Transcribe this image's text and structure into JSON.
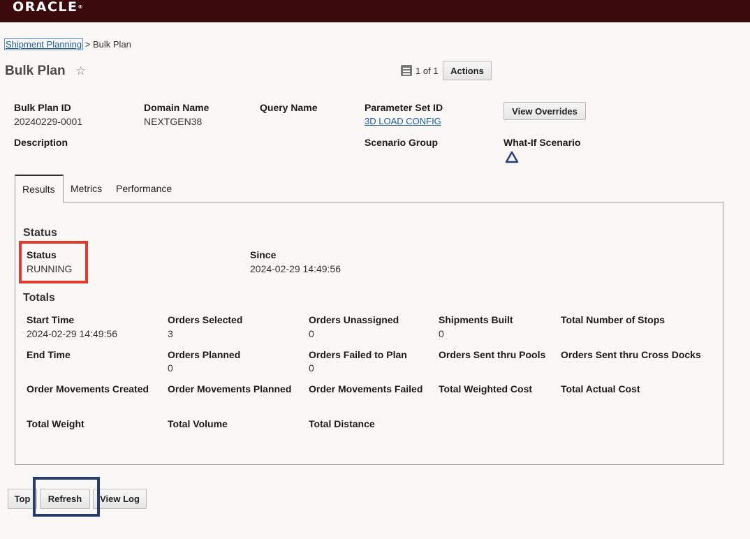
{
  "header": {
    "logo_text": "ORACLE"
  },
  "breadcrumb": {
    "link": "Shipment Planning",
    "separator": ">",
    "current": "Bulk Plan"
  },
  "page": {
    "title": "Bulk Plan",
    "pager": "1 of 1",
    "actions_label": "Actions"
  },
  "summary": {
    "bulk_plan_id_label": "Bulk Plan ID",
    "bulk_plan_id_value": "20240229-0001",
    "domain_name_label": "Domain Name",
    "domain_name_value": "NEXTGEN38",
    "query_name_label": "Query Name",
    "parameter_set_label": "Parameter Set ID",
    "parameter_set_value": "3D LOAD CONFIG",
    "view_overrides_label": "View Overrides",
    "description_label": "Description",
    "scenario_group_label": "Scenario Group",
    "what_if_label": "What-If Scenario"
  },
  "tabs": [
    {
      "label": "Results",
      "active": true
    },
    {
      "label": "Metrics",
      "active": false
    },
    {
      "label": "Performance",
      "active": false
    }
  ],
  "status_section": {
    "title": "Status",
    "status_label": "Status",
    "status_value": "RUNNING",
    "since_label": "Since",
    "since_value": "2024-02-29 14:49:56"
  },
  "totals": {
    "title": "Totals",
    "start_time_label": "Start Time",
    "start_time_value": "2024-02-29 14:49:56",
    "orders_selected_label": "Orders Selected",
    "orders_selected_value": "3",
    "orders_unassigned_label": "Orders Unassigned",
    "orders_unassigned_value": "0",
    "shipments_built_label": "Shipments Built",
    "shipments_built_value": "0",
    "total_stops_label": "Total Number of Stops",
    "end_time_label": "End Time",
    "orders_planned_label": "Orders Planned",
    "orders_planned_value": "0",
    "orders_failed_label": "Orders Failed to Plan",
    "orders_failed_value": "0",
    "orders_pools_label": "Orders Sent thru Pools",
    "orders_cross_docks_label": "Orders Sent thru Cross Docks",
    "om_created_label": "Order Movements Created",
    "om_planned_label": "Order Movements Planned",
    "om_failed_label": "Order Movements Failed",
    "total_weighted_cost_label": "Total Weighted Cost",
    "total_actual_cost_label": "Total Actual Cost",
    "total_weight_label": "Total Weight",
    "total_volume_label": "Total Volume",
    "total_distance_label": "Total Distance"
  },
  "footer": {
    "top_label": "Top",
    "refresh_label": "Refresh",
    "view_log_label": "View Log"
  },
  "colors": {
    "header_bg": "#3a0a0d",
    "link": "#1f5a99",
    "highlight_red": "#e23a2b",
    "highlight_blue": "#253e6b"
  }
}
